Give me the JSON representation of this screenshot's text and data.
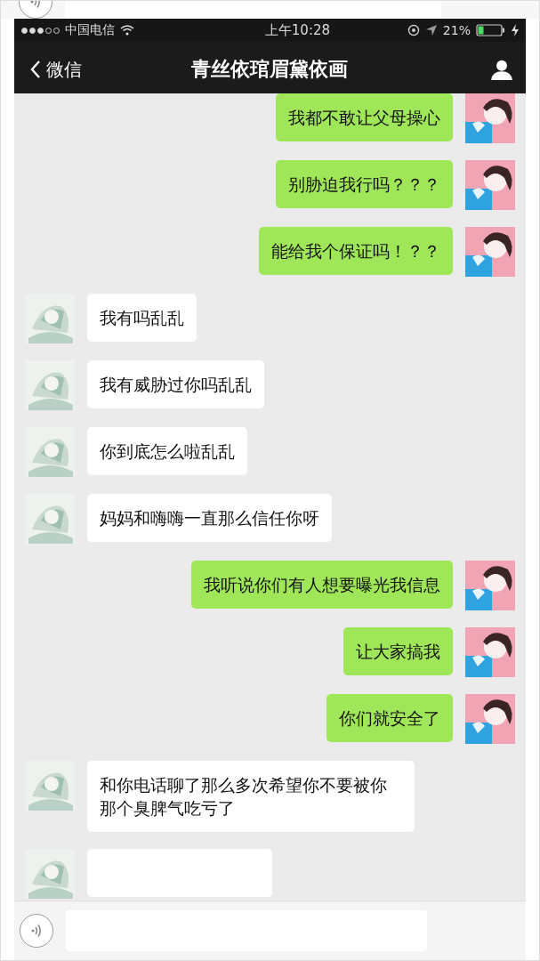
{
  "status_bar": {
    "carrier": "中国电信",
    "time": "上午10:28",
    "battery": "21%"
  },
  "nav": {
    "back_label": "微信",
    "title": "青丝依琯眉黛依画"
  },
  "messages": [
    {
      "outgoing": true,
      "text": "我都不敢让父母操心"
    },
    {
      "outgoing": true,
      "text": "别胁迫我行吗？？？"
    },
    {
      "outgoing": true,
      "text": "能给我个保证吗！？？"
    },
    {
      "outgoing": false,
      "text": "我有吗乱乱"
    },
    {
      "outgoing": false,
      "text": "我有威胁过你吗乱乱"
    },
    {
      "outgoing": false,
      "text": "你到底怎么啦乱乱"
    },
    {
      "outgoing": false,
      "text": "妈妈和嗨嗨一直那么信任你呀"
    },
    {
      "outgoing": true,
      "text": "我听说你们有人想要曝光我信息"
    },
    {
      "outgoing": true,
      "text": "让大家搞我"
    },
    {
      "outgoing": true,
      "text": "你们就安全了"
    },
    {
      "outgoing": false,
      "text": "和你电话聊了那么多次希望你不要被你那个臭脾气吃亏了"
    },
    {
      "outgoing": false
    }
  ]
}
